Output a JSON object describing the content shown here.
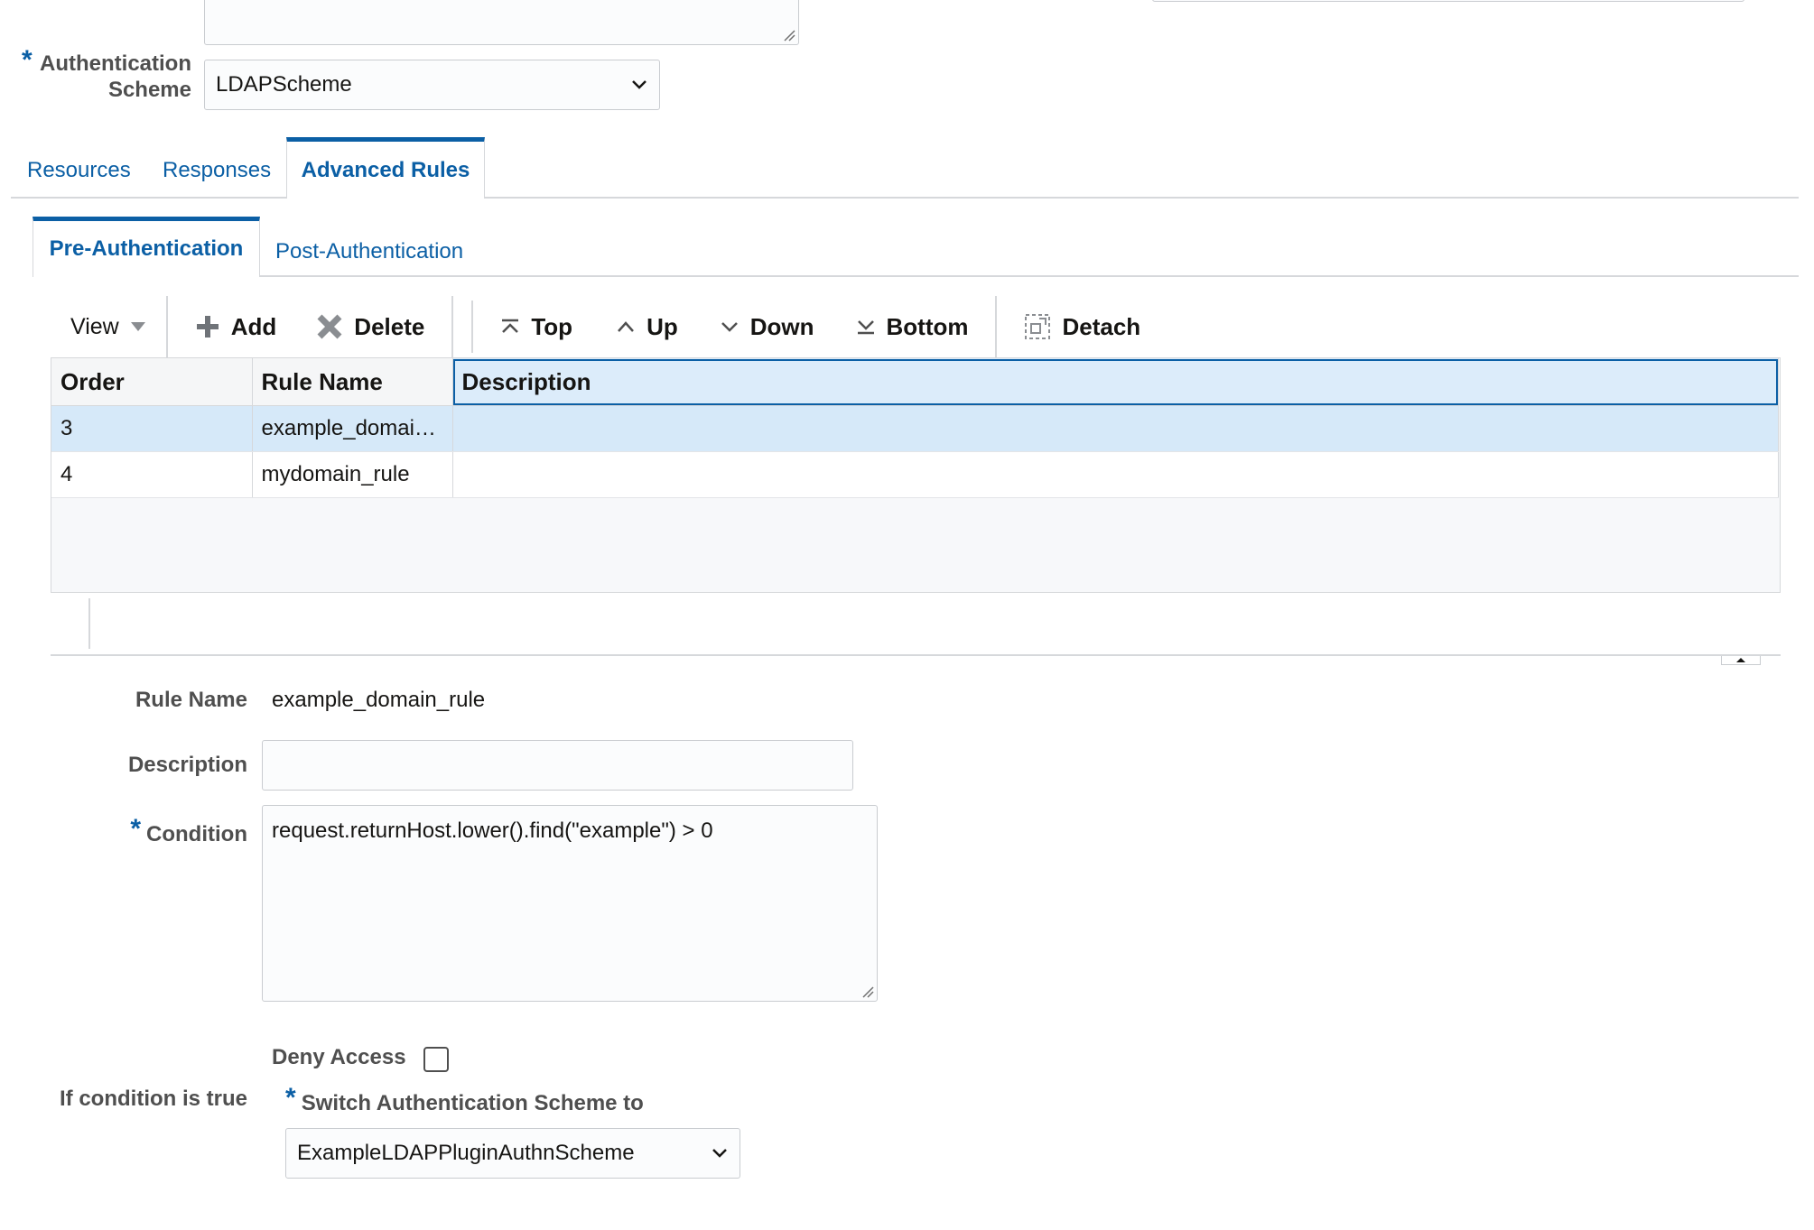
{
  "header": {
    "auth_scheme_label_line1": "Authentication",
    "auth_scheme_label_line2": "Scheme",
    "auth_scheme_value": "LDAPScheme",
    "required_marker": "*"
  },
  "tabs": [
    {
      "label": "Resources",
      "active": false
    },
    {
      "label": "Responses",
      "active": false
    },
    {
      "label": "Advanced Rules",
      "active": true
    }
  ],
  "subtabs": [
    {
      "label": "Pre-Authentication",
      "active": true
    },
    {
      "label": "Post-Authentication",
      "active": false
    }
  ],
  "toolbar": {
    "view": "View",
    "add": "Add",
    "delete": "Delete",
    "top": "Top",
    "up": "Up",
    "down": "Down",
    "bottom": "Bottom",
    "detach": "Detach"
  },
  "table": {
    "columns": [
      "Order",
      "Rule Name",
      "Description"
    ],
    "rows": [
      {
        "order": "3",
        "rule_name": "example_domai…",
        "description": "",
        "selected": true
      },
      {
        "order": "4",
        "rule_name": "mydomain_rule",
        "description": "",
        "selected": false
      }
    ]
  },
  "detail": {
    "rule_name_label": "Rule Name",
    "rule_name_value": "example_domain_rule",
    "description_label": "Description",
    "description_value": "",
    "condition_label": "Condition",
    "condition_value": "request.returnHost.lower().find(\"example\") > 0",
    "if_condition_label": "If condition is true",
    "deny_access_label": "Deny Access",
    "deny_access_checked": false,
    "switch_label": "Switch Authentication Scheme to",
    "switch_value": "ExampleLDAPPluginAuthnScheme"
  },
  "colors": {
    "accent": "#0b5fa5",
    "selected_row": "#d6e9f9",
    "border": "#d6d8db"
  }
}
